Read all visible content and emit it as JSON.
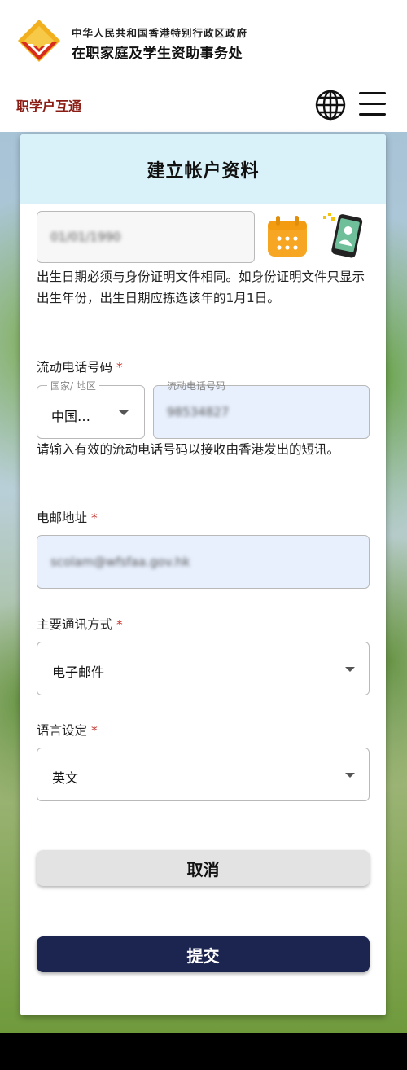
{
  "header": {
    "org_line1": "中华人民共和国香港特别行政区政府",
    "org_line2": "在职家庭及学生资助事务处",
    "portal_link": "职学户互通",
    "language_icon": "globe-icon",
    "menu_icon": "hamburger-menu-icon"
  },
  "form": {
    "title": "建立帐户资料",
    "dob": {
      "value": "01/01/1990",
      "calendar_icon": "calendar-icon",
      "scan_icon": "phone-scan-icon",
      "note": "出生日期必须与身份证明文件相同。如身份证明文件只显示出生年份，出生日期应拣选该年的1月1日。"
    },
    "mobile": {
      "label": "流动电话号码",
      "required_mark": "*",
      "country_label": "国家/ 地区",
      "country_value": "中国…",
      "number_label": "流动电话号码",
      "number_value": "98534827",
      "note": "请输入有效的流动电话号码以接收由香港发出的短讯。"
    },
    "email": {
      "label": "电邮地址",
      "required_mark": "*",
      "value": "scolam@wfsfaa.gov.hk"
    },
    "contact_method": {
      "label": "主要通讯方式",
      "required_mark": "*",
      "value": "电子邮件"
    },
    "language": {
      "label": "语言设定",
      "required_mark": "*",
      "value": "英文"
    },
    "cancel_label": "取消",
    "submit_label": "提交"
  },
  "colors": {
    "header_title_bg": "#d9f1f8",
    "submit_bg": "#1c2550",
    "portal_link": "#8a1c14",
    "required": "#c4312b",
    "autofill_bg": "#e8f0fe"
  }
}
